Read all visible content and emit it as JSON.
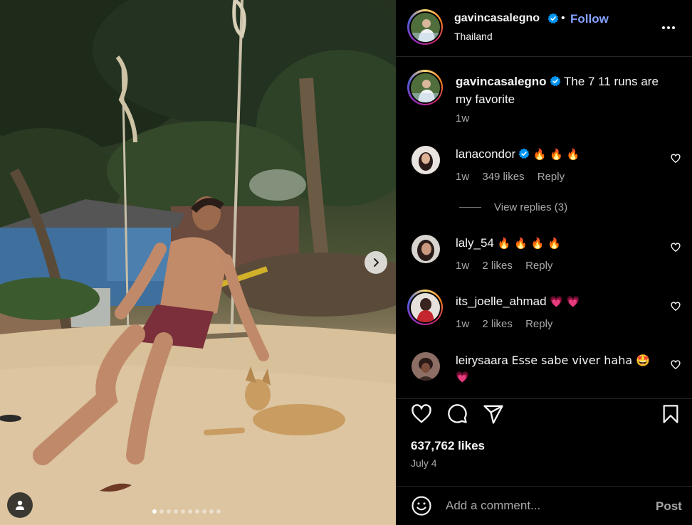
{
  "post": {
    "author": "gavincasalegno",
    "follow_label": "Follow",
    "bullet": "•",
    "location": "Thailand",
    "caption_text": "The 7 11 runs are my favorite",
    "caption_time": "1w",
    "carousel_dots": 10,
    "carousel_active_index": 0,
    "likes": "637,762 likes",
    "date": "July 4"
  },
  "comments": [
    {
      "username": "lanacondor",
      "verified": true,
      "text": "🔥 🔥 🔥",
      "time": "1w",
      "likes": "349 likes",
      "reply_label": "Reply",
      "avatar_color": "#5b3d35"
    },
    {
      "username": "laly_54",
      "verified": false,
      "text": "🔥 🔥 🔥 🔥",
      "time": "1w",
      "likes": "2 likes",
      "reply_label": "Reply",
      "avatar_color": "#6b4a3e"
    },
    {
      "username": "its_joelle_ahmad",
      "verified": false,
      "text": "💗 💗",
      "time": "1w",
      "likes": "2 likes",
      "reply_label": "Reply",
      "avatar_color": "#b3262a"
    },
    {
      "username": "leirysaara",
      "verified": false,
      "text": "Esse sabe viver haha 🤩",
      "text_line2": "💗",
      "avatar_color": "#3a2a26"
    }
  ],
  "view_replies_label": "View replies (3)",
  "comment_input": {
    "placeholder": "Add a comment...",
    "value": ""
  },
  "post_button_label": "Post",
  "icons": {
    "more": "more-horizontal-icon",
    "verified": "verified-badge-icon",
    "like": "heart-icon",
    "comment": "comment-bubble-icon",
    "share": "paper-plane-icon",
    "save": "bookmark-icon",
    "emoji": "smiley-icon",
    "next": "chevron-right-icon",
    "tag": "user-tag-icon"
  },
  "colors": {
    "follow": "#85a1ff",
    "verified": "#0095f6",
    "muted": "#a8a8a8",
    "background": "#000000"
  }
}
